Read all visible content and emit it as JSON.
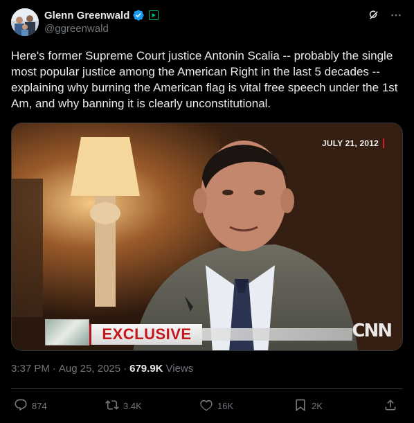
{
  "author": {
    "display_name": "Glenn Greenwald",
    "handle": "@ggreenwald"
  },
  "tweet": {
    "text": "Here's former Supreme Court justice Antonin Scalia -- probably the single most popular justice among the American Right in the last 5 decades -- explaining why burning the American flag is vital free speech under the 1st Am, and why banning it is clearly unconstitutional."
  },
  "media": {
    "date_overlay": "JULY 21, 2012",
    "banner_text": "EXCLUSIVE",
    "network_logo": "CNN"
  },
  "meta": {
    "time": "3:37 PM",
    "separator1": "·",
    "date": "Aug 25, 2025",
    "separator2": "·",
    "views_count": "679.9K",
    "views_label": "Views"
  },
  "actions": {
    "replies": "874",
    "reposts": "3.4K",
    "likes": "16K",
    "bookmarks": "2K"
  },
  "icons": {
    "verified": "verified-badge-icon",
    "affiliate": "affiliate-badge-icon",
    "grok": "grok-icon",
    "more": "more-icon",
    "reply": "reply-icon",
    "repost": "repost-icon",
    "like": "heart-icon",
    "bookmark": "bookmark-icon",
    "share": "share-icon"
  },
  "colors": {
    "background": "#000000",
    "text": "#e7e9ea",
    "muted": "#71767b",
    "verified": "#1d9bf0",
    "affiliate": "#00ba7c",
    "banner_red": "#c4161c"
  }
}
